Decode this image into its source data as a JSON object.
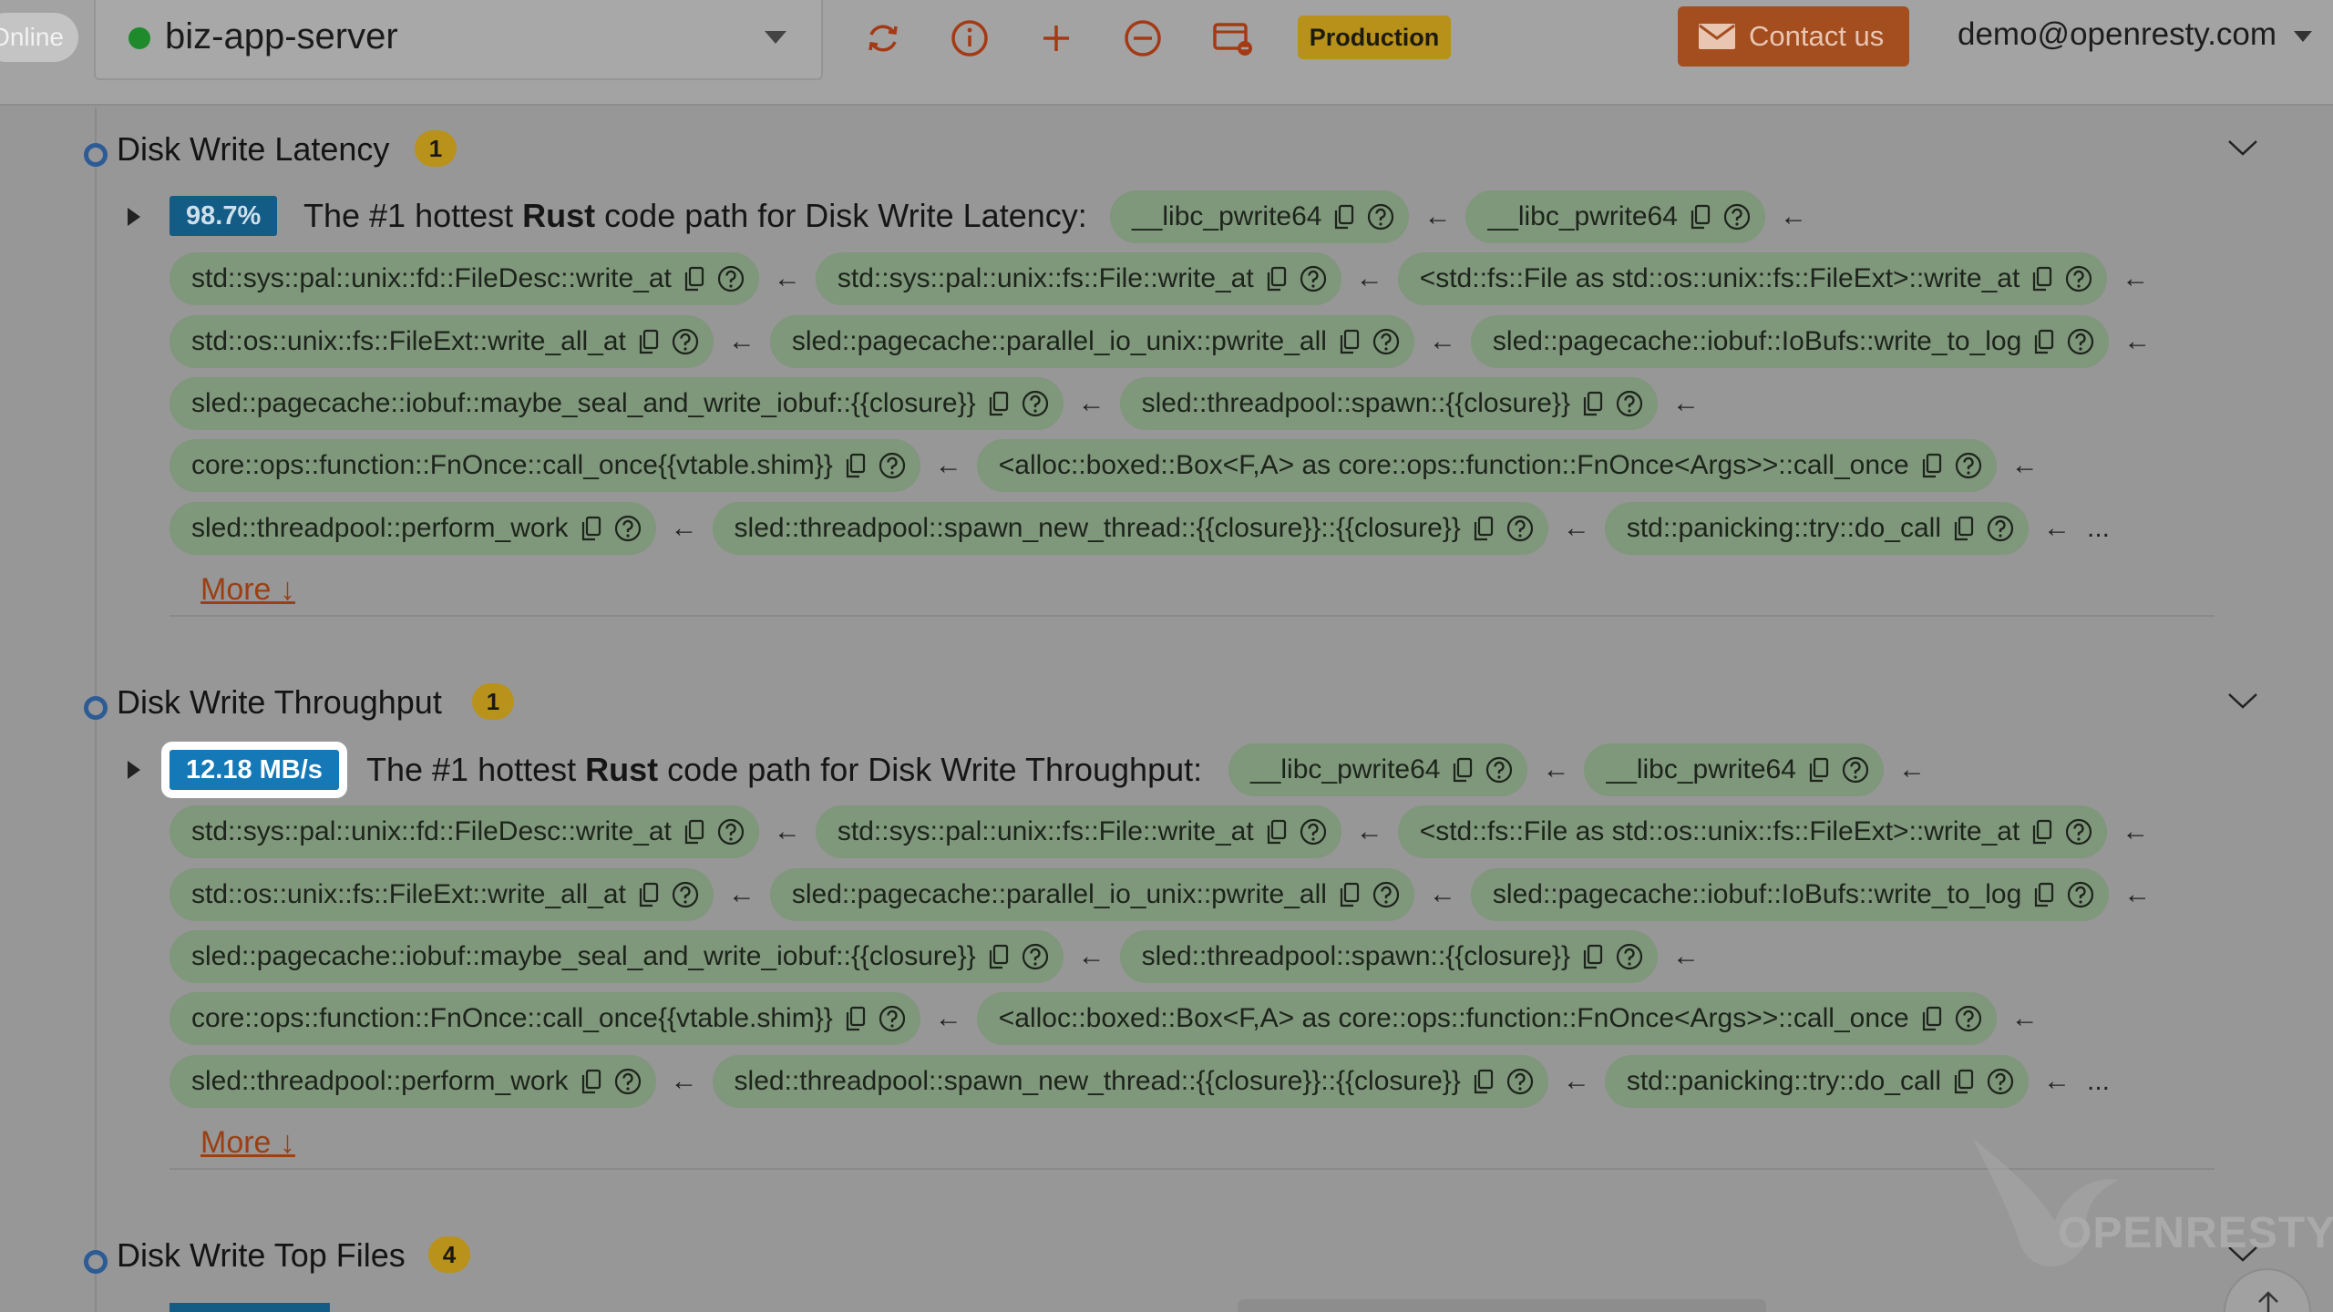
{
  "topbar": {
    "online_label": "Online",
    "server_name": "biz-app-server",
    "server_status_color": "#1f8a2c",
    "icons": [
      "refresh-icon",
      "info-icon",
      "plus-icon",
      "minus-circle-icon",
      "window-close-icon"
    ],
    "environment_badge": "Production",
    "contact_label": "Contact us",
    "user_email": "demo@openresty.com"
  },
  "sections": [
    {
      "title": "Disk Write Latency",
      "count": "1",
      "metric": "98.7%",
      "headline_pre": "The #1 hottest ",
      "headline_lang": "Rust",
      "headline_post": " code path for Disk Write Latency:",
      "more_label": "More ↓",
      "first_row": [
        "__libc_pwrite64",
        "__libc_pwrite64"
      ],
      "rows": [
        [
          "std::sys::pal::unix::fd::FileDesc::write_at",
          "std::sys::pal::unix::fs::File::write_at",
          "<std::fs::File as std::os::unix::fs::FileExt>::write_at"
        ],
        [
          "std::os::unix::fs::FileExt::write_all_at",
          "sled::pagecache::parallel_io_unix::pwrite_all",
          "sled::pagecache::iobuf::IoBufs::write_to_log"
        ],
        [
          "sled::pagecache::iobuf::maybe_seal_and_write_iobuf::{{closure}}",
          "sled::threadpool::spawn::{{closure}}"
        ],
        [
          "core::ops::function::FnOnce::call_once{{vtable.shim}}",
          "<alloc::boxed::Box<F,A> as core::ops::function::FnOnce<Args>>::call_once"
        ],
        [
          "sled::threadpool::perform_work",
          "sled::threadpool::spawn_new_thread::{{closure}}::{{closure}}",
          "std::panicking::try::do_call"
        ]
      ]
    },
    {
      "title": "Disk Write Throughput",
      "count": "1",
      "metric": "12.18 MB/s",
      "headline_pre": "The #1 hottest ",
      "headline_lang": "Rust",
      "headline_post": " code path for Disk Write Throughput:",
      "more_label": "More ↓",
      "first_row": [
        "__libc_pwrite64",
        "__libc_pwrite64"
      ],
      "rows": [
        [
          "std::sys::pal::unix::fd::FileDesc::write_at",
          "std::sys::pal::unix::fs::File::write_at",
          "<std::fs::File as std::os::unix::fs::FileExt>::write_at"
        ],
        [
          "std::os::unix::fs::FileExt::write_all_at",
          "sled::pagecache::parallel_io_unix::pwrite_all",
          "sled::pagecache::iobuf::IoBufs::write_to_log"
        ],
        [
          "sled::pagecache::iobuf::maybe_seal_and_write_iobuf::{{closure}}",
          "sled::threadpool::spawn::{{closure}}"
        ],
        [
          "core::ops::function::FnOnce::call_once{{vtable.shim}}",
          "<alloc::boxed::Box<F,A> as core::ops::function::FnOnce<Args>>::call_once"
        ],
        [
          "sled::threadpool::perform_work",
          "sled::threadpool::spawn_new_thread::{{closure}}::{{closure}}",
          "std::panicking::try::do_call"
        ]
      ]
    },
    {
      "title": "Disk Write Top Files",
      "count": "4"
    }
  ],
  "ui": {
    "arrow": "←",
    "ellipsis": "...",
    "watermark": "OPENRESTY",
    "chip_color": "#7f977b",
    "metric_color": "#135c86",
    "link_color": "#9b3f14"
  }
}
